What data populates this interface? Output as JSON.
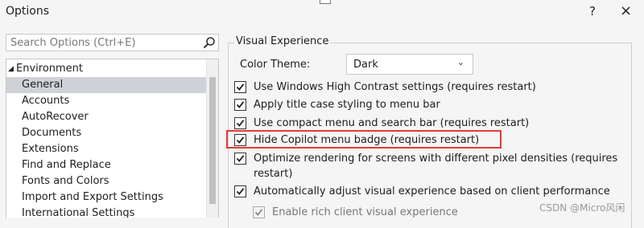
{
  "window": {
    "title": "Options",
    "help_label": "?",
    "close_label": "×"
  },
  "search": {
    "placeholder": "Search Options (Ctrl+E)"
  },
  "tree": {
    "root": {
      "arrow": "◢",
      "label": "Environment"
    },
    "items": [
      {
        "label": "General",
        "selected": true
      },
      {
        "label": "Accounts"
      },
      {
        "label": "AutoRecover"
      },
      {
        "label": "Documents"
      },
      {
        "label": "Extensions"
      },
      {
        "label": "Find and Replace"
      },
      {
        "label": "Fonts and Colors"
      },
      {
        "label": "Import and Export Settings"
      },
      {
        "label": "International Settings"
      }
    ]
  },
  "visual_experience": {
    "legend": "Visual Experience",
    "color_theme_label": "Color Theme:",
    "color_theme_value": "Dark",
    "options": [
      {
        "label": "Use Windows High Contrast settings (requires restart)",
        "checked": true
      },
      {
        "label": "Apply title case styling to menu bar",
        "checked": true
      },
      {
        "label": "Use compact menu and search bar (requires restart)",
        "checked": true
      },
      {
        "label": "Hide Copilot menu badge (requires restart)",
        "checked": true,
        "highlighted": true
      },
      {
        "label_line1": "Optimize rendering for screens with different pixel densities (requires",
        "label_line2": "restart)",
        "checked": true
      },
      {
        "label": "Automatically adjust visual experience based on client performance",
        "checked": true
      },
      {
        "label": "Enable rich client visual experience",
        "checked": true,
        "disabled": true
      }
    ]
  },
  "colors": {
    "highlight": "#e53935",
    "selection": "#cfd3d8"
  },
  "watermark": "CSDN @Micro风闲"
}
